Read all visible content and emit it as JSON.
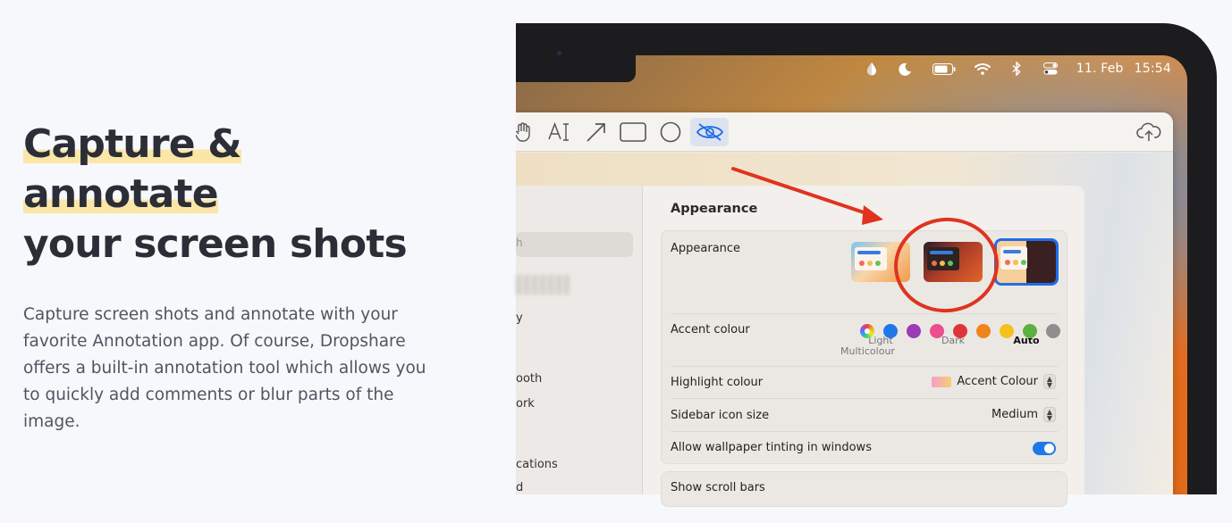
{
  "hero": {
    "title_line1": "Capture & annotate",
    "title_line2": "your screen shots",
    "description": "Capture screen shots and annotate with your favorite Annotation app. Of course, Dropshare offers a built-in annotation tool which allows you to quickly add comments or blur parts of the image."
  },
  "menubar": {
    "icons": [
      "drop-icon",
      "moon-icon",
      "battery-icon",
      "wifi-icon",
      "bluetooth-icon",
      "control-center-icon"
    ],
    "date": "11. Feb",
    "time": "15:54"
  },
  "toolbar": {
    "tools": [
      "hand-icon",
      "text-tool-icon",
      "arrow-tool-icon",
      "rectangle-tool-icon",
      "circle-tool-icon",
      "blur-tool-icon"
    ],
    "text_tool_glyph": "AI",
    "active_tool": "blur-tool-icon",
    "upload": "cloud-upload-icon"
  },
  "settings": {
    "sidebar_search_fragment": "h",
    "sidebar_items": [
      "y",
      "ooth",
      "ork",
      "cations",
      "d"
    ],
    "title": "Appearance",
    "appearance_label": "Appearance",
    "appearance_options": [
      {
        "label": "Light",
        "selected": false
      },
      {
        "label": "Dark",
        "selected": false
      },
      {
        "label": "Auto",
        "selected": true
      }
    ],
    "accent_label": "Accent colour",
    "accent_selected_caption": "Multicolour",
    "accent_colors": [
      "#1f78e8",
      "#9b3bb6",
      "#eb4d8d",
      "#e0343a",
      "#f0841c",
      "#f4c21e",
      "#5bb041",
      "#8e8e8e"
    ],
    "highlight_label": "Highlight colour",
    "highlight_value": "Accent Colour",
    "sidebar_icon_label": "Sidebar icon size",
    "sidebar_icon_value": "Medium",
    "tinting_label": "Allow wallpaper tinting in windows",
    "tinting_on": true,
    "scrollbars_label": "Show scroll bars"
  }
}
